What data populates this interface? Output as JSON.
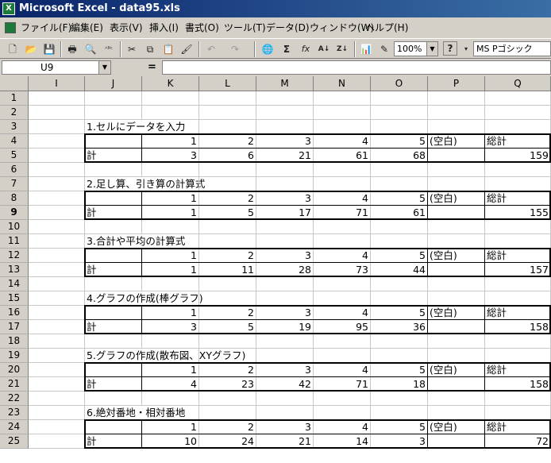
{
  "window": {
    "title": "Microsoft Excel - data95.xls",
    "app_icon_letter": "X"
  },
  "menubar": {
    "items": [
      {
        "key": "file",
        "label": "ファイル(F)"
      },
      {
        "key": "edit",
        "label": "編集(E)"
      },
      {
        "key": "view",
        "label": "表示(V)"
      },
      {
        "key": "insert",
        "label": "挿入(I)"
      },
      {
        "key": "format",
        "label": "書式(O)"
      },
      {
        "key": "tools",
        "label": "ツール(T)"
      },
      {
        "key": "data",
        "label": "データ(D)"
      },
      {
        "key": "window",
        "label": "ウィンドウ(W)"
      },
      {
        "key": "help",
        "label": "ヘルプ(H)"
      }
    ]
  },
  "toolbar": {
    "zoom": "100%",
    "font_name": "MS Pゴシック",
    "buttons": [
      {
        "key": "new",
        "icon": "new-document-icon",
        "glyph": "🗋"
      },
      {
        "key": "open",
        "icon": "open-folder-icon",
        "glyph": "📂"
      },
      {
        "key": "save",
        "icon": "save-disk-icon",
        "glyph": "💾"
      },
      {
        "key": "print",
        "icon": "printer-icon",
        "glyph": "🖶"
      },
      {
        "key": "preview",
        "icon": "print-preview-icon",
        "glyph": "🔍"
      },
      {
        "key": "spelling",
        "icon": "spelling-check-icon",
        "glyph": "ᴬᴮᶜ"
      },
      {
        "key": "cut",
        "icon": "scissors-icon",
        "glyph": "✂"
      },
      {
        "key": "copy",
        "icon": "copy-icon",
        "glyph": "⧉"
      },
      {
        "key": "paste",
        "icon": "paste-clipboard-icon",
        "glyph": "📋"
      },
      {
        "key": "format_painter",
        "icon": "format-painter-icon",
        "glyph": "🖌"
      },
      {
        "key": "undo",
        "icon": "undo-arrow-icon",
        "glyph": "↶"
      },
      {
        "key": "redo",
        "icon": "redo-arrow-icon",
        "glyph": "↷"
      },
      {
        "key": "hyperlink",
        "icon": "hyperlink-globe-icon",
        "glyph": "🌐"
      },
      {
        "key": "autosum",
        "icon": "autosum-sigma-icon",
        "glyph": "Σ"
      },
      {
        "key": "function",
        "icon": "function-fx-icon",
        "glyph": "fx"
      },
      {
        "key": "sort_asc",
        "icon": "sort-ascending-icon",
        "glyph": "A↓"
      },
      {
        "key": "sort_desc",
        "icon": "sort-descending-icon",
        "glyph": "Z↓"
      },
      {
        "key": "chart_wizard",
        "icon": "chart-wizard-icon",
        "glyph": "📊"
      },
      {
        "key": "drawing",
        "icon": "drawing-tools-icon",
        "glyph": "✎"
      },
      {
        "key": "help",
        "icon": "help-question-icon",
        "glyph": "?"
      }
    ]
  },
  "formula_bar": {
    "name_box": "U9",
    "equals": "=",
    "content": ""
  },
  "columns": [
    "I",
    "J",
    "K",
    "L",
    "M",
    "N",
    "O",
    "P",
    "Q"
  ],
  "rows": [
    "1",
    "2",
    "3",
    "4",
    "5",
    "6",
    "7",
    "8",
    "9",
    "10",
    "11",
    "12",
    "13",
    "14",
    "15",
    "16",
    "17",
    "18",
    "19",
    "20",
    "21",
    "22",
    "23",
    "24",
    "25"
  ],
  "active_row": "9",
  "blocks": [
    {
      "title": "1.セルにデータを入力",
      "header": [
        "",
        "1",
        "2",
        "3",
        "4",
        "5",
        "(空白)",
        "総計"
      ],
      "values": [
        "計",
        "3",
        "6",
        "21",
        "61",
        "68",
        "",
        "159"
      ]
    },
    {
      "title": "2.足し算、引き算の計算式",
      "header": [
        "",
        "1",
        "2",
        "3",
        "4",
        "5",
        "(空白)",
        "総計"
      ],
      "values": [
        "計",
        "1",
        "5",
        "17",
        "71",
        "61",
        "",
        "155"
      ]
    },
    {
      "title": "3.合計や平均の計算式",
      "header": [
        "",
        "1",
        "2",
        "3",
        "4",
        "5",
        "(空白)",
        "総計"
      ],
      "values": [
        "計",
        "1",
        "11",
        "28",
        "73",
        "44",
        "",
        "157"
      ]
    },
    {
      "title": "4.グラフの作成(棒グラフ)",
      "header": [
        "",
        "1",
        "2",
        "3",
        "4",
        "5",
        "(空白)",
        "総計"
      ],
      "values": [
        "計",
        "3",
        "5",
        "19",
        "95",
        "36",
        "",
        "158"
      ]
    },
    {
      "title": "5.グラフの作成(散布図、XYグラフ)",
      "header": [
        "",
        "1",
        "2",
        "3",
        "4",
        "5",
        "(空白)",
        "総計"
      ],
      "values": [
        "計",
        "4",
        "23",
        "42",
        "71",
        "18",
        "",
        "158"
      ]
    },
    {
      "title": "6.絶対番地・相対番地",
      "header": [
        "",
        "1",
        "2",
        "3",
        "4",
        "5",
        "(空白)",
        "総計"
      ],
      "values": [
        "計",
        "10",
        "24",
        "21",
        "14",
        "3",
        "",
        "72"
      ]
    }
  ]
}
